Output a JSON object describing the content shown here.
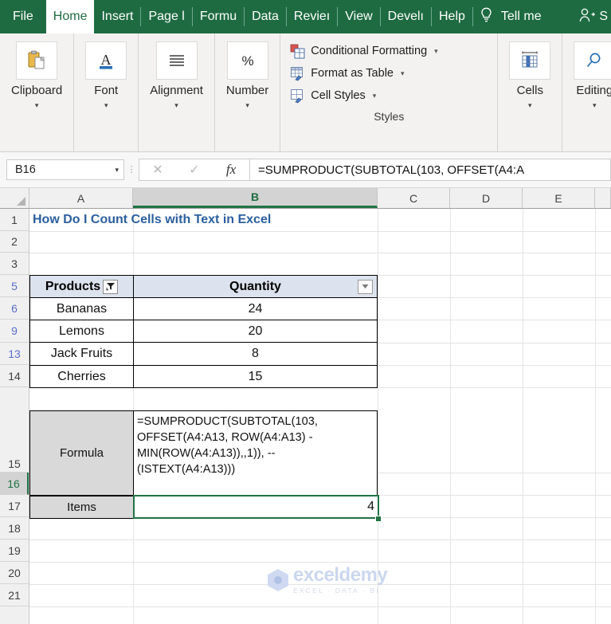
{
  "app": {
    "accent_green": "#1e6b42",
    "selection_green": "#217346"
  },
  "ribbon_tabs": [
    {
      "label": "File",
      "active": false
    },
    {
      "label": "Home",
      "active": true
    },
    {
      "label": "Insert",
      "active": false
    },
    {
      "label": "Page l",
      "active": false
    },
    {
      "label": "Formu",
      "active": false
    },
    {
      "label": "Data",
      "active": false
    },
    {
      "label": "Revieı",
      "active": false
    },
    {
      "label": "View",
      "active": false
    },
    {
      "label": "Develı",
      "active": false
    },
    {
      "label": "Help",
      "active": false
    }
  ],
  "tell_me": {
    "icon": "lightbulb-icon",
    "label": "Tell me"
  },
  "account": {
    "icon": "person-add-icon",
    "label": "S"
  },
  "ribbon_groups": [
    {
      "name": "clipboard",
      "label": "Clipboard",
      "icon": "clipboard-icon",
      "caret": "▾"
    },
    {
      "name": "font",
      "label": "Font",
      "icon": "font-letter-a-icon",
      "caret": "▾"
    },
    {
      "name": "alignment",
      "label": "Alignment",
      "icon": "align-lines-icon",
      "caret": "▾"
    },
    {
      "name": "number",
      "label": "Number",
      "icon": "percent-icon",
      "caret": "▾"
    },
    {
      "name": "cells",
      "label": "Cells",
      "icon": "insert-cells-icon",
      "caret": "▾"
    },
    {
      "name": "editing",
      "label": "Editing",
      "icon": "magnifier-icon",
      "caret": "▾"
    }
  ],
  "styles_group": {
    "title": "Styles",
    "items": [
      {
        "label": "Conditional Formatting",
        "icon": "conditional-formatting-icon",
        "caret": "▾"
      },
      {
        "label": "Format as Table",
        "icon": "format-as-table-icon",
        "caret": "▾"
      },
      {
        "label": "Cell Styles",
        "icon": "cell-styles-icon",
        "caret": "▾"
      }
    ]
  },
  "formula_bar": {
    "name_box_value": "B16",
    "name_box_caret": "▾",
    "cancel_icon": "✕",
    "enter_icon": "✓",
    "fx_label": "fx",
    "formula_text": "=SUMPRODUCT(SUBTOTAL(103, OFFSET(A4:A"
  },
  "sheet": {
    "columns": [
      {
        "label": "A",
        "selected": false
      },
      {
        "label": "B",
        "selected": true
      },
      {
        "label": "C",
        "selected": false
      },
      {
        "label": "D",
        "selected": false
      },
      {
        "label": "E",
        "selected": false
      }
    ],
    "rows": [
      {
        "num": "1",
        "filtered": false,
        "selected": false
      },
      {
        "num": "2",
        "filtered": false,
        "selected": false
      },
      {
        "num": "3",
        "filtered": false,
        "selected": false
      },
      {
        "num": "5",
        "filtered": true,
        "selected": false
      },
      {
        "num": "6",
        "filtered": true,
        "selected": false
      },
      {
        "num": "9",
        "filtered": true,
        "selected": false
      },
      {
        "num": "13",
        "filtered": true,
        "selected": false
      },
      {
        "num": "14",
        "filtered": false,
        "selected": false
      },
      {
        "num": "15",
        "filtered": false,
        "selected": false
      },
      {
        "num": "16",
        "filtered": false,
        "selected": true
      },
      {
        "num": "17",
        "filtered": false,
        "selected": false
      },
      {
        "num": "18",
        "filtered": false,
        "selected": false
      },
      {
        "num": "19",
        "filtered": false,
        "selected": false
      },
      {
        "num": "20",
        "filtered": false,
        "selected": false
      },
      {
        "num": "21",
        "filtered": false,
        "selected": false
      }
    ],
    "title_cell": "How Do I Count Cells with Text in Excel",
    "table": {
      "headers": [
        "Products",
        "Quantity"
      ],
      "products_filter_icon": "filter-active-icon",
      "quantity_filter_icon": "dropdown-arrow-icon",
      "rows": [
        {
          "product": "Bananas",
          "quantity": "24"
        },
        {
          "product": "Lemons",
          "quantity": "20"
        },
        {
          "product": "Jack Fruits",
          "quantity": "8"
        },
        {
          "product": "Cherries",
          "quantity": "15"
        }
      ]
    },
    "formula_row": {
      "label": "Formula",
      "text": "=SUMPRODUCT(SUBTOTAL(103,\nOFFSET(A4:A13, ROW(A4:A13) -\nMIN(ROW(A4:A13)),,1)), --\n(ISTEXT(A4:A13)))"
    },
    "items_row": {
      "label": "Items",
      "value": "4"
    }
  },
  "watermark": {
    "name": "exceldemy",
    "tagline": "EXCEL · DATA · BI"
  }
}
